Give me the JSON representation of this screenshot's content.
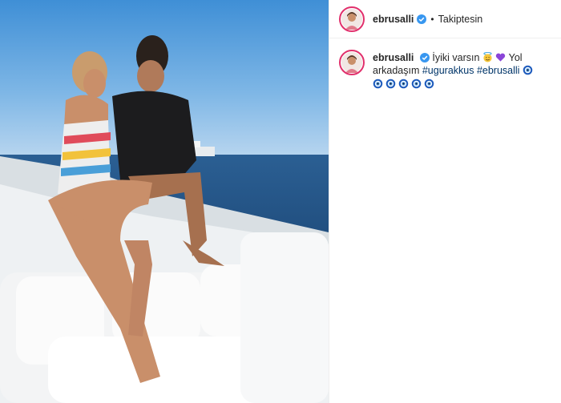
{
  "post": {
    "username": "ebrusalli",
    "follow_status": "Takiptesin",
    "separator": "•"
  },
  "caption": {
    "username": "ebrusalli",
    "text_1": "İyiki varsın",
    "text_2": "Yol arkadaşım",
    "hashtag_1": "#ugurakkus",
    "hashtag_2": "#ebrusalli"
  },
  "icons": {
    "verified": "verified-badge-icon",
    "smile": "smiling-face-with-halo-icon",
    "heart": "purple-heart-icon",
    "eye": "nazar-evil-eye-icon"
  },
  "colors": {
    "verified": "#3897f0",
    "hashtag": "#003569",
    "story_ring": "#e1306c",
    "heart": "#8a45d8",
    "eye": "#1d5bbd"
  }
}
